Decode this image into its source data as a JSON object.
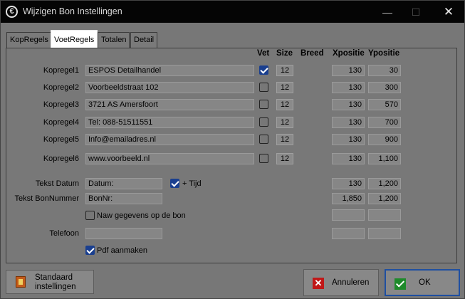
{
  "window": {
    "title": "Wijzigen Bon Instellingen",
    "app_icon": "espos-logo-icon",
    "controls": {
      "minimize": "—",
      "maximize": "☐",
      "close": "✕"
    }
  },
  "tabs": [
    {
      "label": "KopRegels",
      "active": false
    },
    {
      "label": "VoetRegels",
      "active": true
    },
    {
      "label": "Totalen",
      "active": false
    },
    {
      "label": "Detail",
      "active": false
    }
  ],
  "columns": {
    "vet": "Vet",
    "size": "Size",
    "breed": "Breed",
    "xpositie": "Xpositie",
    "ypositie": "Ypositie"
  },
  "rows": [
    {
      "label": "Kopregel1",
      "value": "ESPOS Detailhandel",
      "vet": true,
      "size": "12",
      "x": "130",
      "y": "30"
    },
    {
      "label": "Kopregel2",
      "value": "Voorbeeldstraat 102",
      "vet": false,
      "size": "12",
      "x": "130",
      "y": "300"
    },
    {
      "label": "Kopregel3",
      "value": "3721 AS  Amersfoort",
      "vet": false,
      "size": "12",
      "x": "130",
      "y": "570"
    },
    {
      "label": "Kopregel4",
      "value": "Tel: 088-51511551",
      "vet": false,
      "size": "12",
      "x": "130",
      "y": "700"
    },
    {
      "label": "Kopregel5",
      "value": "Info@emailadres.nl",
      "vet": false,
      "size": "12",
      "x": "130",
      "y": "900"
    },
    {
      "label": "Kopregel6",
      "value": "www.voorbeeld.nl",
      "vet": false,
      "size": "12",
      "x": "130",
      "y": "1,100"
    }
  ],
  "tekst_datum": {
    "label": "Tekst Datum",
    "value": "Datum:",
    "tijd_label": "+ Tijd",
    "tijd_checked": true,
    "x": "130",
    "y": "1,200"
  },
  "tekst_bonnummer": {
    "label": "Tekst BonNummer",
    "value": "BonNr:",
    "x": "1,850",
    "y": "1,200"
  },
  "naw": {
    "label": "Naw gegevens op de bon",
    "checked": false,
    "x": "",
    "y": ""
  },
  "telefoon": {
    "label": "Telefoon",
    "value": "",
    "x": "",
    "y": ""
  },
  "pdf": {
    "label": "Pdf aanmaken",
    "checked": true
  },
  "buttons": {
    "standaard_line1": "Standaard",
    "standaard_line2": "instellingen",
    "annuleren": "Annuleren",
    "ok": "OK"
  }
}
